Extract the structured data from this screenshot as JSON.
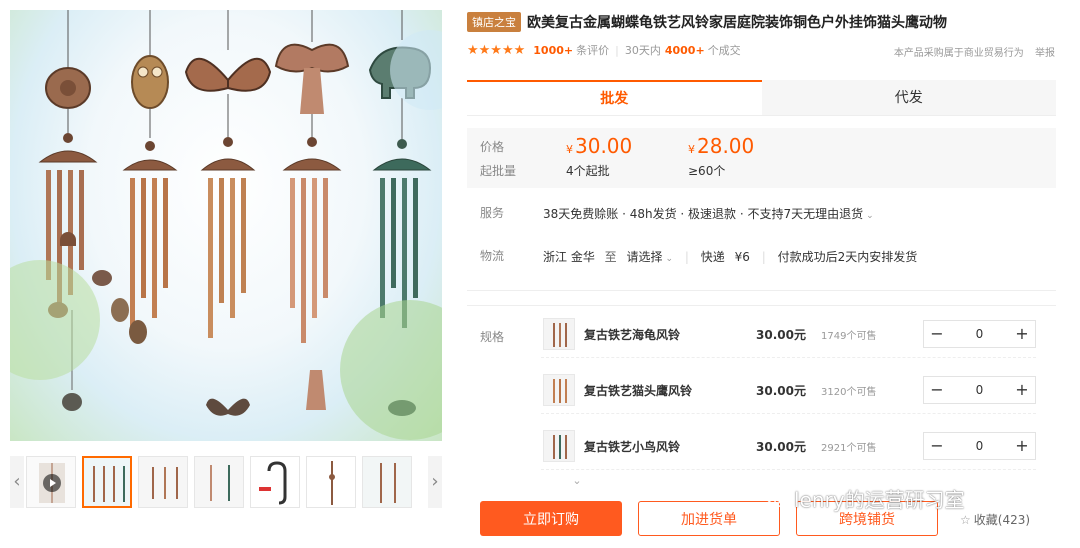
{
  "title": {
    "badge": "镇店之宝",
    "text": "欧美复古金属蝴蝶龟铁艺风铃家居庭院装饰铜色户外挂饰猫头鹰动物"
  },
  "rating": {
    "stars": "★★★★★",
    "review_count": "1000+",
    "review_label": "条评价",
    "period_label": "30天内",
    "deal_count": "4000+",
    "deal_label": "个成交",
    "notice": "本产品采购属于商业贸易行为",
    "report": "举报"
  },
  "tabs": [
    {
      "label": "批发"
    },
    {
      "label": "代发"
    }
  ],
  "price_box": {
    "price_label": "价格",
    "moq_label": "起批量",
    "currency": "¥",
    "tiers": [
      {
        "price": "30.00",
        "moq": "4个起批"
      },
      {
        "price": "28.00",
        "moq": "≥60个"
      }
    ]
  },
  "service": {
    "label": "服务",
    "value": "38天免费赊账 · 48h发货 · 极速退款 · 不支持7天无理由退货",
    "dropdown": "⌄"
  },
  "logistics": {
    "label": "物流",
    "from": "浙江 金华",
    "to_label": "至",
    "to_value": "请选择",
    "dropdown": "⌄",
    "express": "快递",
    "express_fee": "¥6",
    "ship_note": "付款成功后2天内安排发货"
  },
  "specs": {
    "label": "规格",
    "items": [
      {
        "name": "复古铁艺海龟风铃",
        "price": "30.00元",
        "stock": "1749个可售",
        "qty": "0"
      },
      {
        "name": "复古铁艺猫头鹰风铃",
        "price": "30.00元",
        "stock": "3120个可售",
        "qty": "0"
      },
      {
        "name": "复古铁艺小鸟风铃",
        "price": "30.00元",
        "stock": "2921个可售",
        "qty": "0"
      }
    ],
    "minus": "−",
    "plus": "+",
    "more": "⌄"
  },
  "actions": {
    "buy": "立即订购",
    "add_cart": "加进货单",
    "cross_border": "跨境铺货",
    "favorite_star": "☆",
    "favorite": "收藏(423)"
  },
  "gallery": {
    "left_arrow": "‹",
    "right_arrow": "›"
  },
  "watermark": "lenry的运营研习室",
  "colors": {
    "accent": "#ff5a1f",
    "badge": "#c9803e",
    "copper": "#a0664a",
    "verdigris": "#3d6a5c"
  }
}
